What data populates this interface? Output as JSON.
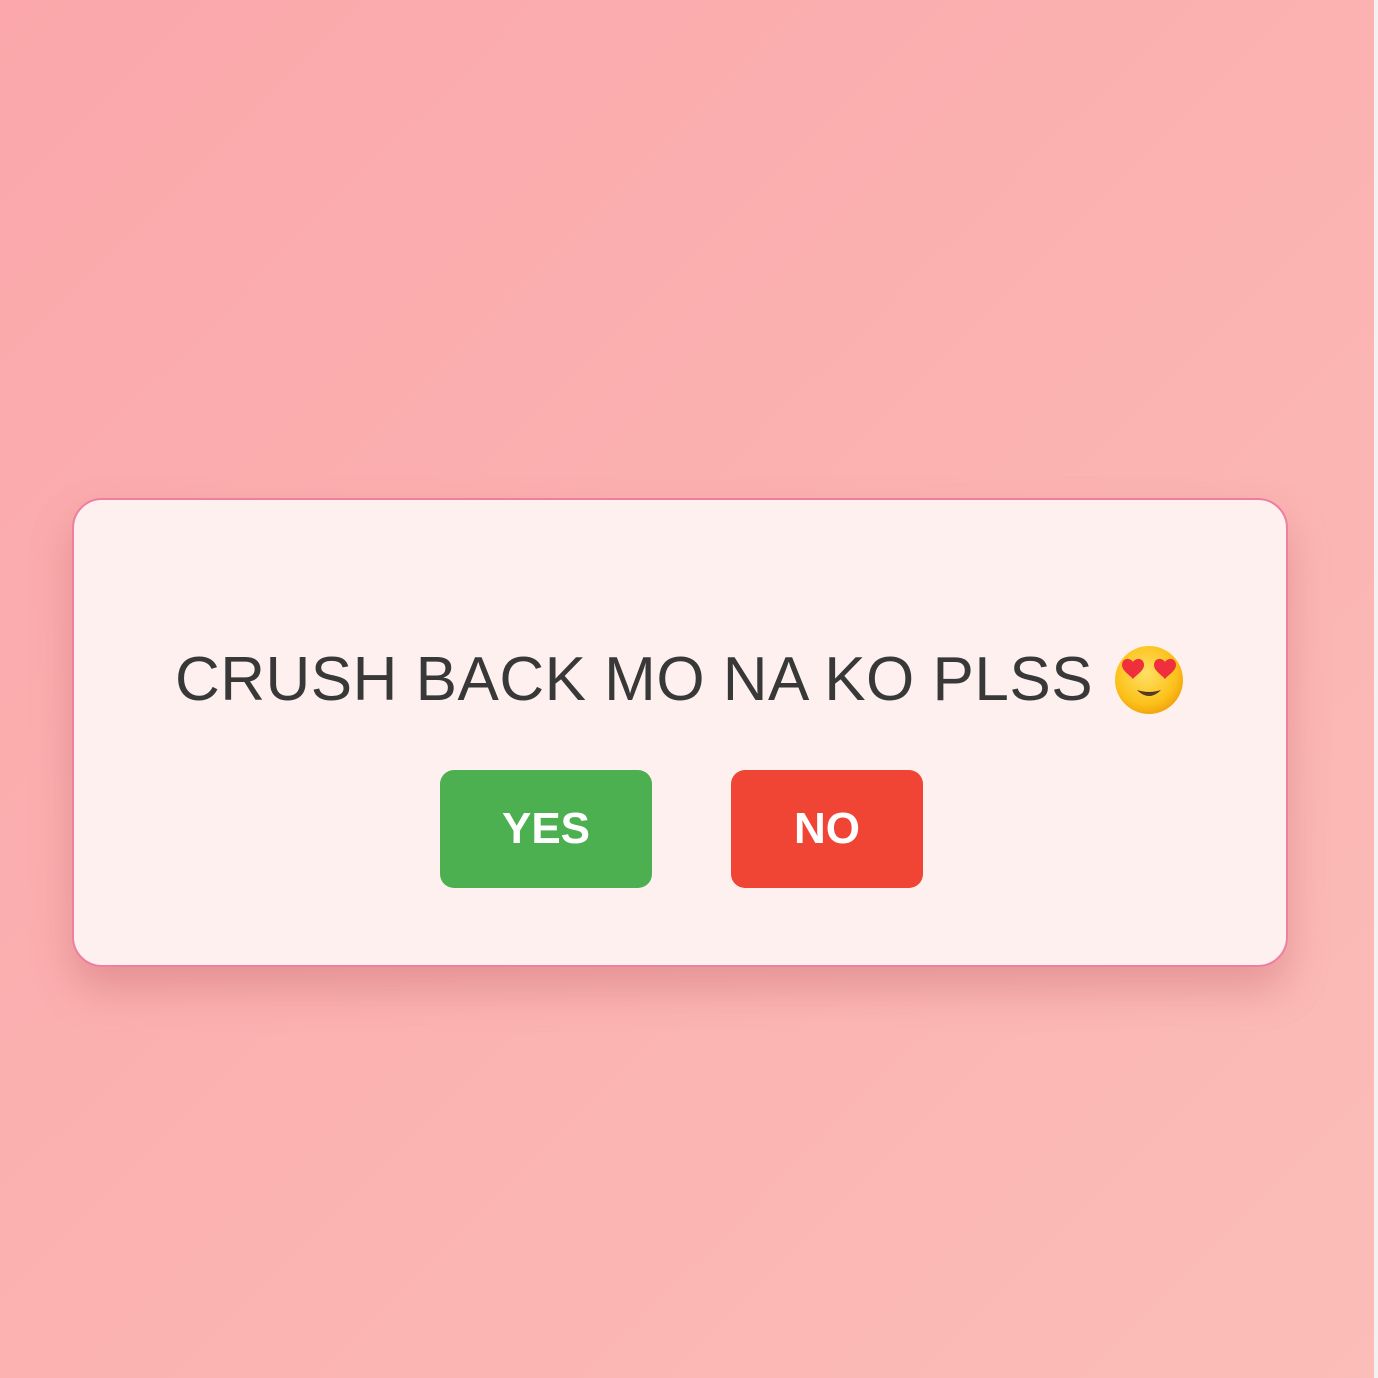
{
  "dialog": {
    "question": "CRUSH BACK MO NA KO PLSS",
    "emoji_icon": "smiling-face-with-heart-eyes",
    "yes_label": "YES",
    "no_label": "NO"
  },
  "colors": {
    "background": "#fbb0b0",
    "card_background": "#fff0f0",
    "card_border": "#ef7fa0",
    "text": "#383838",
    "yes_button": "#4caf50",
    "no_button": "#f04535",
    "button_text": "#ffffff"
  }
}
